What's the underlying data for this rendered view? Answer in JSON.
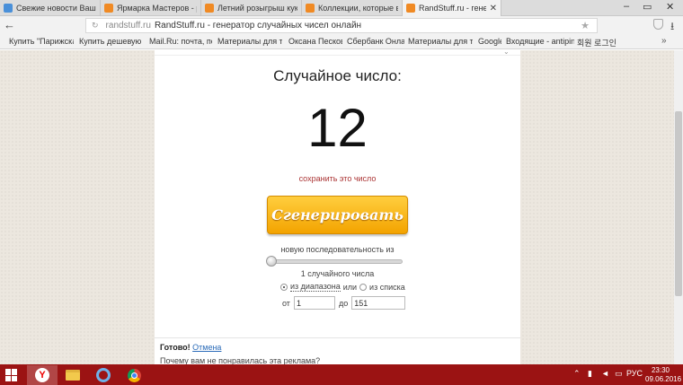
{
  "tabs": [
    {
      "label": "Свежие новости Вашего к",
      "favicon_color": "#4a90d9",
      "active": false
    },
    {
      "label": "Ярмарка Мастеров - ручн",
      "favicon_color": "#f08a24",
      "active": false
    },
    {
      "label": "Летний розыгрыш кукольн",
      "favicon_color": "#f08a24",
      "active": false
    },
    {
      "label": "Коллекции, которые выш",
      "favicon_color": "#f08a24",
      "active": false
    },
    {
      "label": "RandStuff.ru - генерато",
      "favicon_color": "#f08a24",
      "active": true
    }
  ],
  "window_controls": {
    "minimize": "–",
    "maximize": "▭",
    "close": "✕"
  },
  "address": {
    "domain": "randstuff.ru",
    "title": "RandStuff.ru - генератор случайных чисел онлайн"
  },
  "bookmarks": [
    "Купить \"Парижская",
    "Купить дешевую од",
    "Mail.Ru: почта, поиск",
    "Материалы для твор",
    "Оксана Пескова",
    "Сбербанк Онлайн",
    "Материалы для твор",
    "Google",
    "Входящие - antipina",
    "회원 로그인"
  ],
  "main": {
    "heading": "Случайное число:",
    "number": "12",
    "save_link": "сохранить это число",
    "generate_button": "Сгенерировать",
    "sequence_label": "новую последовательность из",
    "count_label": "1 случайного числа",
    "radio_range": "из диапазона",
    "radio_or": "или",
    "radio_list": "из списка",
    "from_label": "от",
    "from_value": "1",
    "to_label": "до",
    "to_value": "151"
  },
  "ad": {
    "done": "Готово!",
    "cancel": "Отмена",
    "question": "Почему вам не понравилась эта реклама?"
  },
  "taskbar": {
    "lang": "РУС",
    "time": "23:30",
    "date": "09.06.2016",
    "accent": "#9b1313"
  }
}
